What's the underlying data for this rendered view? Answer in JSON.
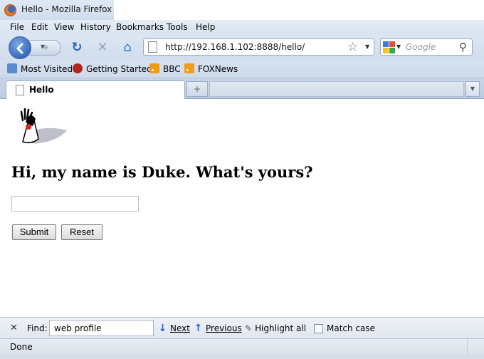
{
  "window": {
    "title": "Hello - Mozilla Firefox"
  },
  "menu": [
    "File",
    "Edit",
    "View",
    "History",
    "Bookmarks",
    "Tools",
    "Help"
  ],
  "navbar": {
    "url": "http://192.168.1.102:8888/hello/",
    "search_placeholder": "Google"
  },
  "bookmarks": [
    "Most Visited",
    "Getting Started",
    "BBC",
    "FOXNews"
  ],
  "tab": {
    "label": "Hello"
  },
  "page": {
    "heading": "Hi, my name is Duke. What's yours?",
    "name_value": "",
    "submit_label": "Submit",
    "reset_label": "Reset"
  },
  "findbar": {
    "label": "Find:",
    "query": "web profile",
    "next": "Next",
    "previous": "Previous",
    "highlight": "Highlight all",
    "match_case": "Match case"
  },
  "status": {
    "text": "Done"
  },
  "colors": {
    "accent": "#2a66c9",
    "rss": "#f29b17",
    "back_button": "#1f4fa8"
  }
}
